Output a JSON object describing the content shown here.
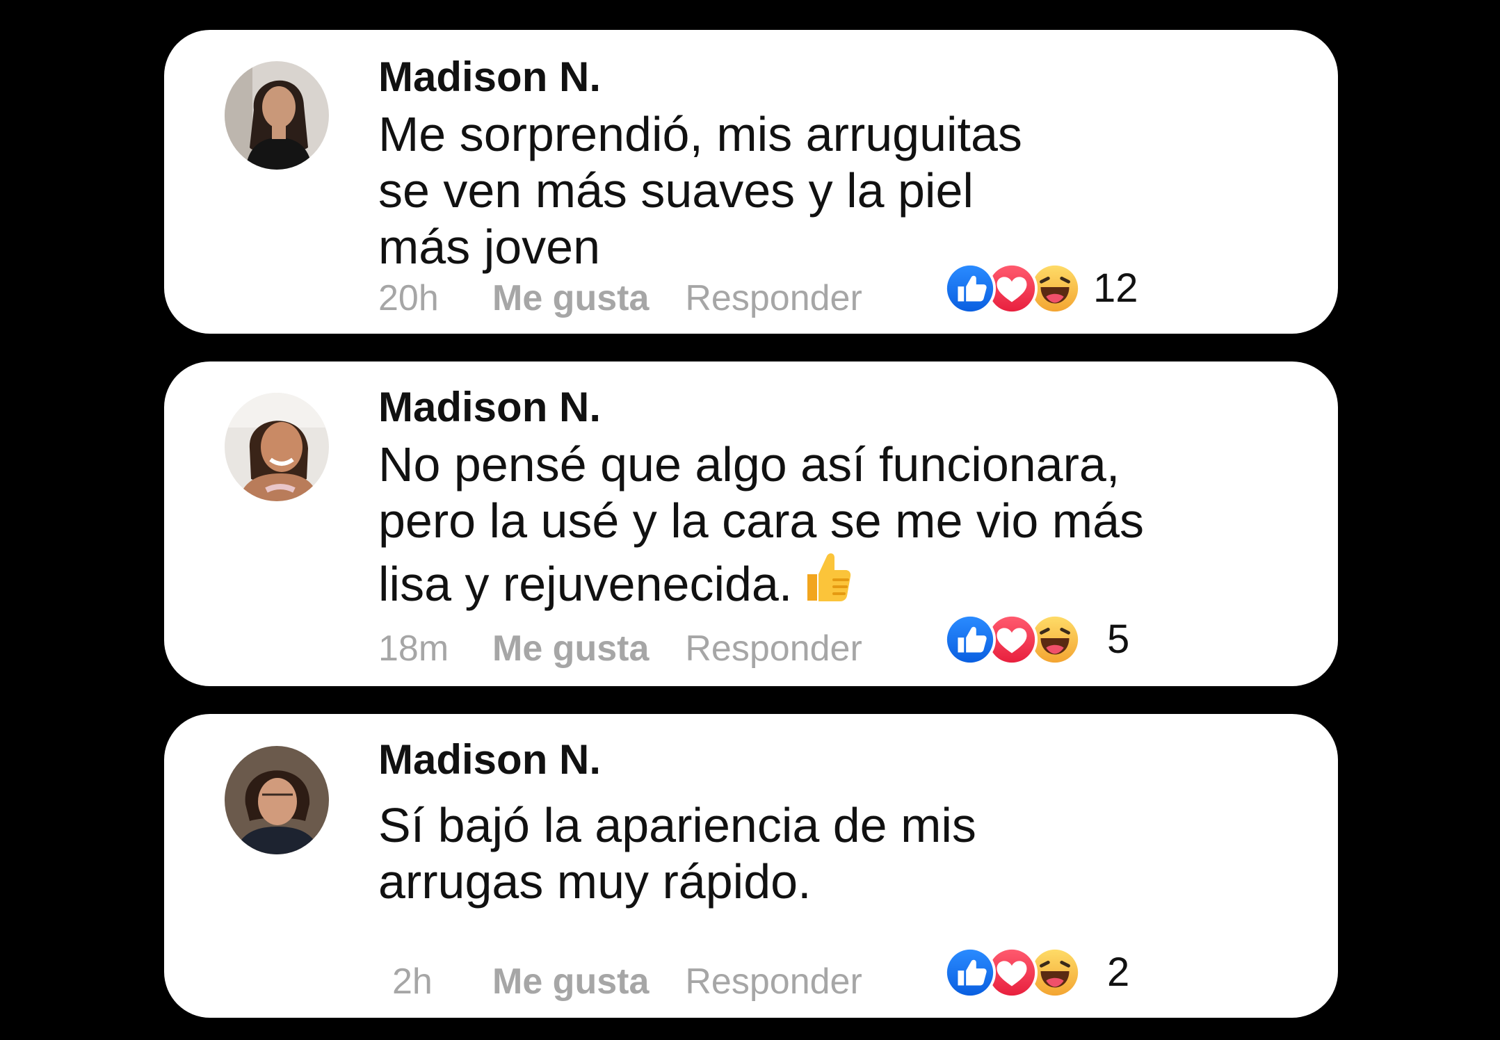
{
  "comments": [
    {
      "author": "Madison N.",
      "lines": [
        "Me sorprendió, mis arruguitas",
        "se ven más suaves y la piel",
        "más joven"
      ],
      "time": "20h",
      "like_label": "Me gusta",
      "reply_label": "Responder",
      "reaction_count": "12",
      "reactions": [
        "like-icon",
        "love-icon",
        "haha-icon"
      ]
    },
    {
      "author": "Madison N.",
      "lines": [
        "No pensé que algo así funcionara,",
        "pero la usé y la cara se me vio más",
        "lisa y rejuvenecida."
      ],
      "trailing_emoji": "thumbs-up-icon",
      "time": "18m",
      "like_label": "Me gusta",
      "reply_label": "Responder",
      "reaction_count": "5",
      "reactions": [
        "like-icon",
        "love-icon",
        "haha-icon"
      ]
    },
    {
      "author": "Madison N.",
      "lines": [
        "Sí bajó la apariencia de mis",
        "arrugas muy rápido."
      ],
      "time": "2h",
      "like_label": "Me gusta",
      "reply_label": "Responder",
      "reaction_count": "2",
      "reactions": [
        "like-icon",
        "love-icon",
        "haha-icon"
      ]
    }
  ],
  "colors": {
    "background": "#000000",
    "card": "#ffffff",
    "meta_text": "#a6a6a6",
    "like_blue": "#1877f2",
    "love_red": "#f33e58",
    "haha_yellow": "#f7c84a"
  }
}
